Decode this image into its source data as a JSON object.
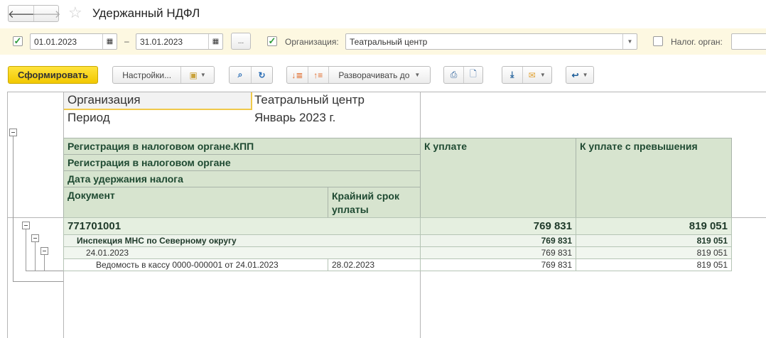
{
  "window": {
    "title": "Удержанный НДФЛ"
  },
  "filters": {
    "period_enabled": true,
    "date_from": "01.01.2023",
    "dash": "–",
    "date_to": "31.01.2023",
    "more_label": "...",
    "org_enabled": true,
    "org_label": "Организация:",
    "org_value": "Театральный центр",
    "tax_enabled": false,
    "tax_label": "Налог. орган:",
    "tax_value": ""
  },
  "toolbar": {
    "generate": "Сформировать",
    "settings": "Настройки...",
    "expand_to": "Разворачивать до"
  },
  "report": {
    "params": [
      {
        "label": "Организация",
        "value": "Театральный центр"
      },
      {
        "label": "Период",
        "value": "Январь 2023 г."
      }
    ],
    "headers": {
      "kpp": "Регистрация в налоговом органе.КПП",
      "reg": "Регистрация в налоговом органе",
      "date": "Дата удержания налога",
      "doc": "Документ",
      "deadline": "Крайний срок уплаты",
      "to_pay": "К уплате",
      "to_pay_excess": "К уплате с превышения"
    },
    "rows": [
      {
        "label": "771701001",
        "deadline": "",
        "to_pay": "769 831",
        "excess": "819 051"
      },
      {
        "label": "Инспекция МНС по Северному округу",
        "deadline": "",
        "to_pay": "769 831",
        "excess": "819 051"
      },
      {
        "label": "24.01.2023",
        "deadline": "",
        "to_pay": "769 831",
        "excess": "819 051"
      },
      {
        "label": "Ведомость в кассу 0000-000001 от 24.01.2023",
        "deadline": "28.02.2023",
        "to_pay": "769 831",
        "excess": "819 051"
      }
    ]
  },
  "colors": {
    "accent": "#f5d000",
    "header_bg": "#d7e4cf",
    "filter_bg": "#fdf8e1"
  }
}
